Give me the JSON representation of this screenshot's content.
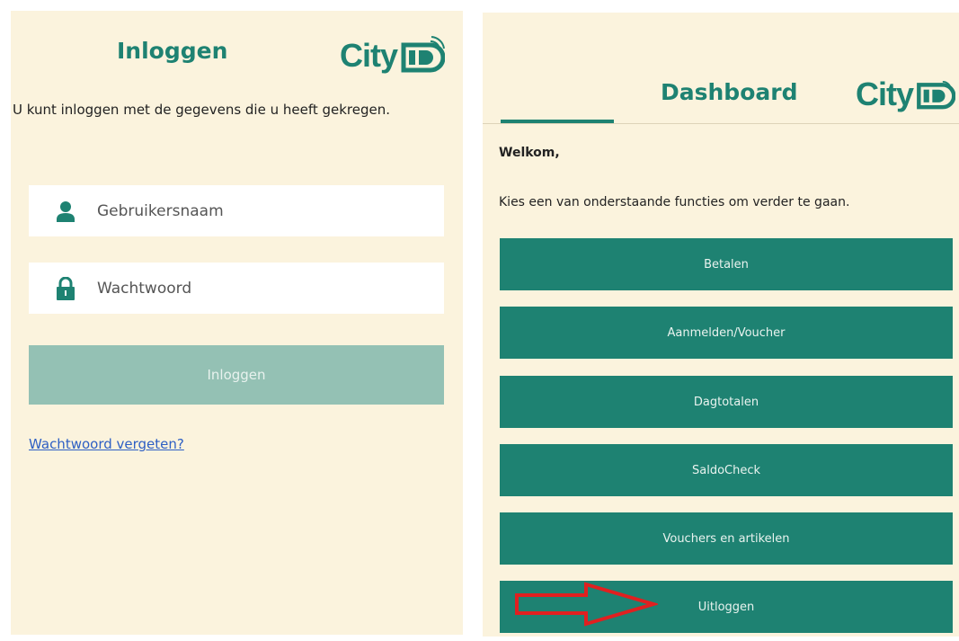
{
  "login": {
    "title": "Inloggen",
    "logo_text": "City",
    "intro": "U kunt inloggen met de gegevens die u heeft gekregen.",
    "username_placeholder": "Gebruikersnaam",
    "password_placeholder": "Wachtwoord",
    "submit_label": "Inloggen",
    "forgot_link": "Wachtwoord vergeten?",
    "icons": [
      "user-icon",
      "lock-icon"
    ]
  },
  "dashboard": {
    "title": "Dashboard",
    "logo_text": "City",
    "welcome": "Welkom,",
    "instruction": "Kies een van onderstaande functies om verder te gaan.",
    "menu": [
      "Betalen",
      "Aanmelden/Voucher",
      "Dagtotalen",
      "SaldoCheck",
      "Vouchers en artikelen",
      "Uitloggen"
    ],
    "annotation": "red-arrow-icon"
  },
  "colors": {
    "background": "#fbf3dd",
    "brand": "#1e8272",
    "disabled_button": "#94c1b4",
    "link": "#2d5fc4",
    "annotation": "#e02020"
  }
}
